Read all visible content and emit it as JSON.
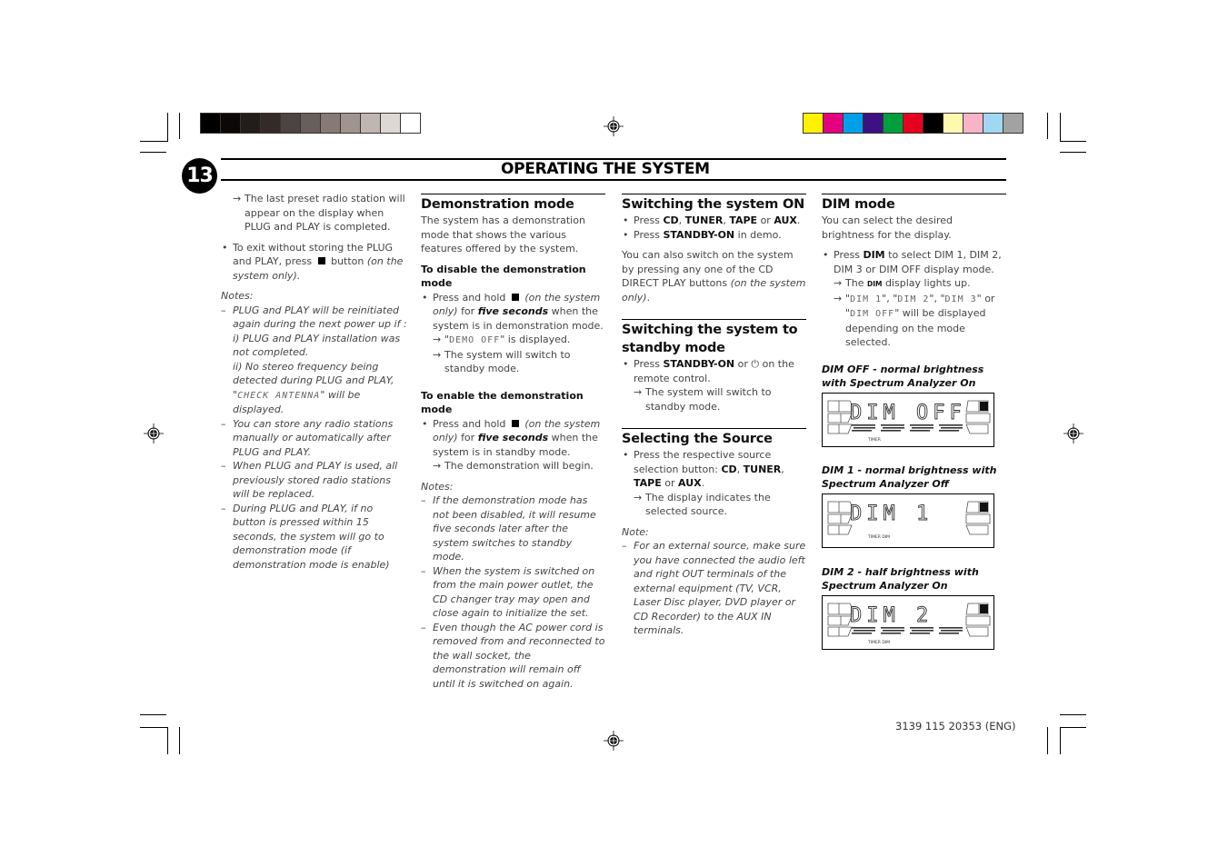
{
  "print_marks": {
    "grayscale_swatches": [
      "#000000",
      "#0b0807",
      "#221d1b",
      "#342b29",
      "#4b4442",
      "#675f5c",
      "#857a76",
      "#a0948f",
      "#c0b6b1",
      "#ddd8d4",
      "#ffffff"
    ],
    "color_swatches": [
      "#fff200",
      "#e4007f",
      "#00a0e9",
      "#3d1083",
      "#009e3c",
      "#e60020",
      "#000000",
      "#fff9b0",
      "#f7b4c8",
      "#a0d8f3",
      "#a2a2a2"
    ]
  },
  "header": {
    "page_number": "13",
    "title": "OPERATING THE SYSTEM"
  },
  "col1": {
    "arrow1": "The last preset radio station will appear on the display when PLUG and PLAY is completed.",
    "bullet1_pre": "To exit without storing the PLUG and PLAY, press",
    "bullet1_post": "button",
    "bullet1_italic": "(on the system only).",
    "notes_label": "Notes:",
    "note1_a": "PLUG and PLAY will be reinitiated again during the next power up if :",
    "note1_b": "i) PLUG and PLAY installation was not completed.",
    "note1_c_pre": "ii) No stereo frequency being detected during PLUG and PLAY, \"",
    "note1_c_lcd": "CHECK ANTENNA",
    "note1_c_post": "\" will be displayed.",
    "note2": "You can store any radio stations manually or automatically after PLUG and PLAY.",
    "note3": "When PLUG and PLAY is used, all previously stored radio stations will be replaced.",
    "note4": "During PLUG and PLAY, if no button is pressed within 15 seconds, the system will go to demonstration mode (if demonstration mode is enable)"
  },
  "col2": {
    "heading": "Demonstration mode",
    "intro": "The system has a demonstration mode that shows the various features offered by the system.",
    "disable_heading": "To disable the demonstration mode",
    "disable_pre": "Press and hold",
    "disable_italic": "(on the system only)",
    "disable_for": "for",
    "disable_bold": "five seconds",
    "disable_post": "when the system is in demonstration mode.",
    "disable_arrow1_lcd": "DEMO OFF",
    "disable_arrow1_post": "is displayed.",
    "disable_arrow2": "The system will switch to standby mode.",
    "enable_heading": "To enable the demonstration mode",
    "enable_pre": "Press and hold",
    "enable_italic": "(on the system only)",
    "enable_for": "for",
    "enable_bold": "five seconds",
    "enable_post": "when the system is in standby mode.",
    "enable_arrow": "The demonstration will begin.",
    "notes_label": "Notes:",
    "note1": "If the demonstration mode has not been disabled, it will resume five seconds later after the system switches to standby mode.",
    "note2": "When the system is switched on from the main power outlet, the CD changer tray may open and close again to initialize the set.",
    "note3": "Even though the AC power cord is removed from and reconnected to the wall socket, the demonstration will remain off until it is switched on again."
  },
  "col3": {
    "on_heading": "Switching the system ON",
    "on_b1_press": "Press",
    "on_b1_cd": "CD",
    "on_b1_tuner": "TUNER",
    "on_b1_tape": "TAPE",
    "on_b1_or": "or",
    "on_b1_aux": "AUX",
    "on_b2_press": "Press",
    "on_b2_bold": "STANDBY-ON",
    "on_b2_post": "in demo.",
    "on_para": "You can also switch on the system by pressing any one of the CD DIRECT PLAY buttons",
    "on_para_italic": "(on the system only)",
    "standby_heading": "Switching the system to standby mode",
    "standby_press": "Press",
    "standby_bold": "STANDBY-ON",
    "standby_or": "or",
    "standby_post": "on the remote control.",
    "standby_arrow": "The system will switch to standby mode.",
    "source_heading": "Selecting the Source",
    "source_pre": "Press the respective source selection button:",
    "source_cd": "CD",
    "source_tuner": "TUNER",
    "source_tape": "TAPE",
    "source_or": "or",
    "source_aux": "AUX",
    "source_arrow": "The display indicates the selected source.",
    "note_label": "Note:",
    "note": "For an external source, make sure you have connected the audio left and right OUT terminals of the external equipment (TV, VCR, Laser Disc player, DVD player or CD Recorder) to the AUX IN terminals."
  },
  "col4": {
    "heading": "DIM mode",
    "intro": "You can select the desired brightness for the display.",
    "b1_press": "Press",
    "b1_bold": "DIM",
    "b1_post": "to select DIM 1, DIM 2, DIM 3 or DIM OFF display mode.",
    "arrow1_pre": "The",
    "arrow1_small": "DIM",
    "arrow1_post": "display lights up.",
    "arrow2_lcd1": "DIM 1",
    "arrow2_lcd2": "DIM 2",
    "arrow2_lcd3": "DIM 3",
    "arrow2_or": "or",
    "arrow2_lcd4": "DIM OFF",
    "arrow2_post": "will be displayed depending on the mode selected.",
    "displays": [
      {
        "caption": "DIM OFF - normal brightness with Spectrum Analyzer On",
        "lcd": "DIM OFF",
        "indicators": "TIMER",
        "spectrum": true
      },
      {
        "caption": "DIM 1 - normal brightness with Spectrum Analyzer Off",
        "lcd": "DIM  1",
        "indicators": "TIMER   DIM",
        "spectrum": false
      },
      {
        "caption": "DIM 2 - half brightness with Spectrum Analyzer On",
        "lcd": "DIM  2",
        "indicators": "TIMER   DIM",
        "spectrum": true
      }
    ]
  },
  "footer": {
    "code": "3139 115 20353 (ENG)"
  }
}
